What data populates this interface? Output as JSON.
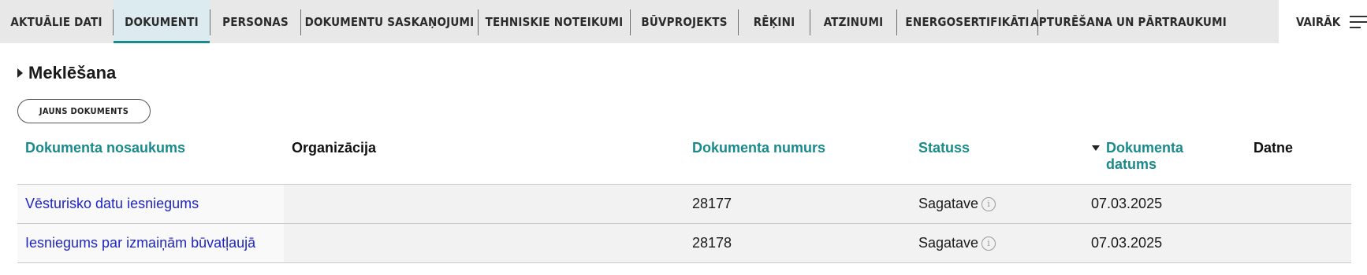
{
  "tabs": [
    {
      "label": "AKTUĀLIE DATI",
      "active": false
    },
    {
      "label": "DOKUMENTI",
      "active": true
    },
    {
      "label": "PERSONAS",
      "active": false
    },
    {
      "label": "DOKUMENTU SASKAŅOJUMI",
      "active": false
    },
    {
      "label": "TEHNISKIE NOTEIKUMI",
      "active": false
    },
    {
      "label": "BŪVPROJEKTS",
      "active": false
    },
    {
      "label": "RĒĶINI",
      "active": false
    },
    {
      "label": "ATZINUMI",
      "active": false
    },
    {
      "label": "ENERGOSERTIFIKĀTI",
      "active": false
    },
    {
      "label": "APTURĒŠANA UN PĀRTRAUKUMI",
      "active": false
    }
  ],
  "more_label": "VAIRĀK",
  "search": {
    "title": "Meklēšana",
    "icon": "caret-right-icon"
  },
  "new_doc_button": "JAUNS DOKUMENTS",
  "table": {
    "headers": {
      "name": "Dokumenta nosaukums",
      "org": "Organizācija",
      "number": "Dokumenta numurs",
      "status": "Statuss",
      "date_line1": "Dokumenta",
      "date_line2": "datums",
      "file": "Datne"
    },
    "rows": [
      {
        "name": "Vēsturisko datu iesniegums",
        "org": "",
        "number": "28177",
        "status": "Sagatave",
        "date": "07.03.2025",
        "file": ""
      },
      {
        "name": "Iesniegums par izmaiņām būvatļaujā",
        "org": "",
        "number": "28178",
        "status": "Sagatave",
        "date": "07.03.2025",
        "file": ""
      }
    ]
  },
  "colors": {
    "accent": "#1a8a8a",
    "link": "#1f25c7",
    "tabbar": "#e8e8e8",
    "active_tab": "#dcebef"
  }
}
